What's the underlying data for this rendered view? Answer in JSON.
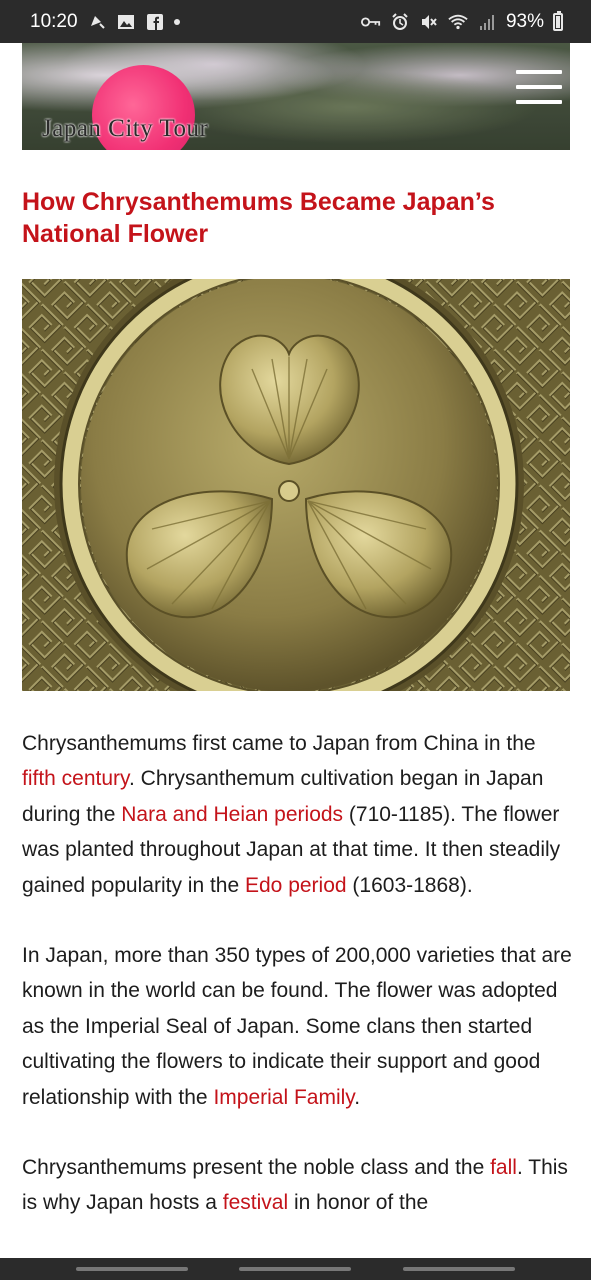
{
  "status_bar": {
    "time": "10:20",
    "battery": "93%",
    "left_icons": [
      "notification-muted-icon",
      "gallery-icon",
      "facebook-icon",
      "more-dot-icon"
    ],
    "right_icons": [
      "vpn-key-icon",
      "alarm-icon",
      "mute-icon",
      "wifi-icon",
      "signal-icon",
      "battery-icon"
    ]
  },
  "header": {
    "logo_text": "Japan City Tour",
    "accent_color": "#f01f69"
  },
  "article": {
    "title": "How Chrysanthemums Became Japan’s National Flower",
    "title_color": "#c4131a",
    "image_subject": "Tokugawa hollyhock crest in gold",
    "paragraphs": [
      {
        "t1": "Chrysanthemums first came to Japan from China in the ",
        "l1": "fifth century",
        "t2": ". Chrysanthemum cultivation began in Japan during the ",
        "l2": "Nara and Heian periods",
        "t3": " (710-1185). The flower was planted throughout Japan at that time. It then steadily gained popularity in the ",
        "l3": "Edo period",
        "t4": " (1603-1868)."
      },
      {
        "t1": "In Japan, more than 350 types of 200,000 varieties that are known in the world can be found. The flower was adopted as the Imperial Seal of Japan. Some clans then started cultivating the flowers to indicate their support and good relationship with the ",
        "l1": "Imperial Family",
        "t2": "."
      },
      {
        "t1": "Chrysanthemums present the noble class and the ",
        "l1": "fall",
        "t2": ". This is why Japan hosts a ",
        "l2": "festival",
        "t3": " in honor of the"
      }
    ]
  }
}
